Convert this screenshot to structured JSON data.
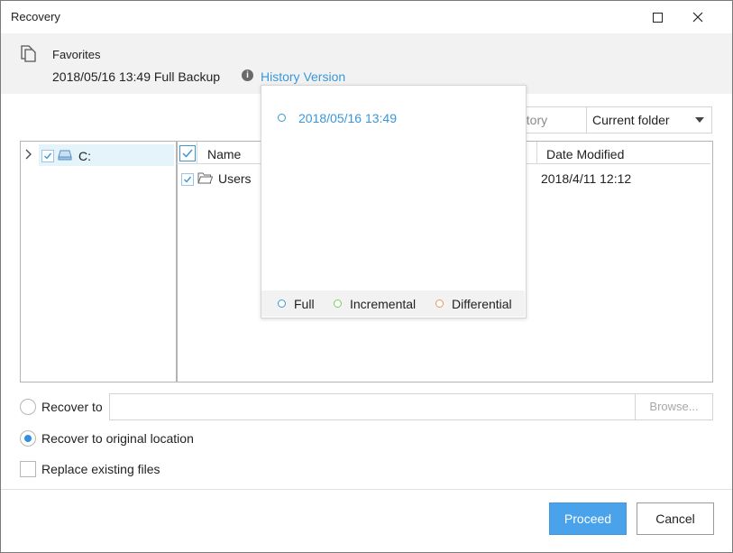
{
  "window": {
    "title": "Recovery"
  },
  "info": {
    "favorites_label": "Favorites",
    "backup_line": "2018/05/16 13:49 Full Backup",
    "history_link": "History Version"
  },
  "toolbar": {
    "view_partial": "ectory",
    "folder_select": "Current folder"
  },
  "tree": {
    "drive_label": "C:"
  },
  "file_table": {
    "columns": [
      "Name",
      "Date Modified"
    ],
    "rows": [
      {
        "name": "Users",
        "date_modified": "2018/4/11 12:12"
      }
    ]
  },
  "history_popup": {
    "versions": [
      "2018/05/16 13:49"
    ],
    "legend": [
      {
        "label": "Full",
        "color": "#3a97d8"
      },
      {
        "label": "Incremental",
        "color": "#7cc95b"
      },
      {
        "label": "Differential",
        "color": "#e8975a"
      }
    ]
  },
  "options": {
    "recover_to_label": "Recover to",
    "recover_to_path": "",
    "browse_label": "Browse...",
    "recover_original_label": "Recover to original location",
    "recover_original_selected": true,
    "replace_existing_label": "Replace existing files",
    "replace_existing_checked": false
  },
  "buttons": {
    "proceed": "Proceed",
    "cancel": "Cancel"
  },
  "colors": {
    "accent": "#3a97d8",
    "primary_button": "#4aa3ea"
  }
}
